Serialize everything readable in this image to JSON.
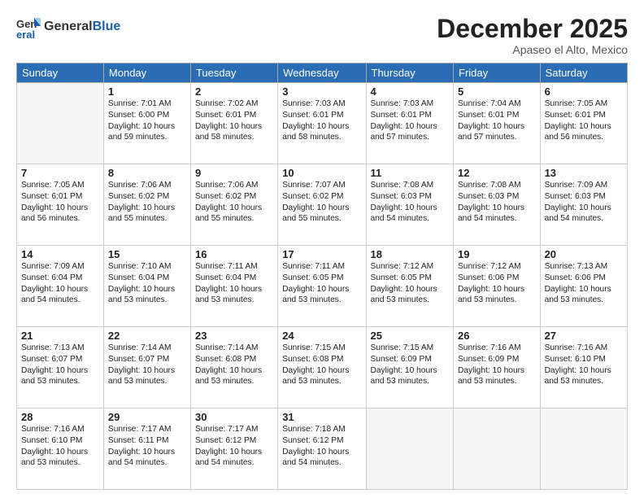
{
  "header": {
    "logo_general": "General",
    "logo_blue": "Blue",
    "month": "December 2025",
    "location": "Apaseo el Alto, Mexico"
  },
  "days_of_week": [
    "Sunday",
    "Monday",
    "Tuesday",
    "Wednesday",
    "Thursday",
    "Friday",
    "Saturday"
  ],
  "weeks": [
    [
      {
        "day": "",
        "content": ""
      },
      {
        "day": "1",
        "content": "Sunrise: 7:01 AM\nSunset: 6:00 PM\nDaylight: 10 hours\nand 59 minutes."
      },
      {
        "day": "2",
        "content": "Sunrise: 7:02 AM\nSunset: 6:01 PM\nDaylight: 10 hours\nand 58 minutes."
      },
      {
        "day": "3",
        "content": "Sunrise: 7:03 AM\nSunset: 6:01 PM\nDaylight: 10 hours\nand 58 minutes."
      },
      {
        "day": "4",
        "content": "Sunrise: 7:03 AM\nSunset: 6:01 PM\nDaylight: 10 hours\nand 57 minutes."
      },
      {
        "day": "5",
        "content": "Sunrise: 7:04 AM\nSunset: 6:01 PM\nDaylight: 10 hours\nand 57 minutes."
      },
      {
        "day": "6",
        "content": "Sunrise: 7:05 AM\nSunset: 6:01 PM\nDaylight: 10 hours\nand 56 minutes."
      }
    ],
    [
      {
        "day": "7",
        "content": "Sunrise: 7:05 AM\nSunset: 6:01 PM\nDaylight: 10 hours\nand 56 minutes."
      },
      {
        "day": "8",
        "content": "Sunrise: 7:06 AM\nSunset: 6:02 PM\nDaylight: 10 hours\nand 55 minutes."
      },
      {
        "day": "9",
        "content": "Sunrise: 7:06 AM\nSunset: 6:02 PM\nDaylight: 10 hours\nand 55 minutes."
      },
      {
        "day": "10",
        "content": "Sunrise: 7:07 AM\nSunset: 6:02 PM\nDaylight: 10 hours\nand 55 minutes."
      },
      {
        "day": "11",
        "content": "Sunrise: 7:08 AM\nSunset: 6:03 PM\nDaylight: 10 hours\nand 54 minutes."
      },
      {
        "day": "12",
        "content": "Sunrise: 7:08 AM\nSunset: 6:03 PM\nDaylight: 10 hours\nand 54 minutes."
      },
      {
        "day": "13",
        "content": "Sunrise: 7:09 AM\nSunset: 6:03 PM\nDaylight: 10 hours\nand 54 minutes."
      }
    ],
    [
      {
        "day": "14",
        "content": "Sunrise: 7:09 AM\nSunset: 6:04 PM\nDaylight: 10 hours\nand 54 minutes."
      },
      {
        "day": "15",
        "content": "Sunrise: 7:10 AM\nSunset: 6:04 PM\nDaylight: 10 hours\nand 53 minutes."
      },
      {
        "day": "16",
        "content": "Sunrise: 7:11 AM\nSunset: 6:04 PM\nDaylight: 10 hours\nand 53 minutes."
      },
      {
        "day": "17",
        "content": "Sunrise: 7:11 AM\nSunset: 6:05 PM\nDaylight: 10 hours\nand 53 minutes."
      },
      {
        "day": "18",
        "content": "Sunrise: 7:12 AM\nSunset: 6:05 PM\nDaylight: 10 hours\nand 53 minutes."
      },
      {
        "day": "19",
        "content": "Sunrise: 7:12 AM\nSunset: 6:06 PM\nDaylight: 10 hours\nand 53 minutes."
      },
      {
        "day": "20",
        "content": "Sunrise: 7:13 AM\nSunset: 6:06 PM\nDaylight: 10 hours\nand 53 minutes."
      }
    ],
    [
      {
        "day": "21",
        "content": "Sunrise: 7:13 AM\nSunset: 6:07 PM\nDaylight: 10 hours\nand 53 minutes."
      },
      {
        "day": "22",
        "content": "Sunrise: 7:14 AM\nSunset: 6:07 PM\nDaylight: 10 hours\nand 53 minutes."
      },
      {
        "day": "23",
        "content": "Sunrise: 7:14 AM\nSunset: 6:08 PM\nDaylight: 10 hours\nand 53 minutes."
      },
      {
        "day": "24",
        "content": "Sunrise: 7:15 AM\nSunset: 6:08 PM\nDaylight: 10 hours\nand 53 minutes."
      },
      {
        "day": "25",
        "content": "Sunrise: 7:15 AM\nSunset: 6:09 PM\nDaylight: 10 hours\nand 53 minutes."
      },
      {
        "day": "26",
        "content": "Sunrise: 7:16 AM\nSunset: 6:09 PM\nDaylight: 10 hours\nand 53 minutes."
      },
      {
        "day": "27",
        "content": "Sunrise: 7:16 AM\nSunset: 6:10 PM\nDaylight: 10 hours\nand 53 minutes."
      }
    ],
    [
      {
        "day": "28",
        "content": "Sunrise: 7:16 AM\nSunset: 6:10 PM\nDaylight: 10 hours\nand 53 minutes."
      },
      {
        "day": "29",
        "content": "Sunrise: 7:17 AM\nSunset: 6:11 PM\nDaylight: 10 hours\nand 54 minutes."
      },
      {
        "day": "30",
        "content": "Sunrise: 7:17 AM\nSunset: 6:12 PM\nDaylight: 10 hours\nand 54 minutes."
      },
      {
        "day": "31",
        "content": "Sunrise: 7:18 AM\nSunset: 6:12 PM\nDaylight: 10 hours\nand 54 minutes."
      },
      {
        "day": "",
        "content": ""
      },
      {
        "day": "",
        "content": ""
      },
      {
        "day": "",
        "content": ""
      }
    ]
  ]
}
